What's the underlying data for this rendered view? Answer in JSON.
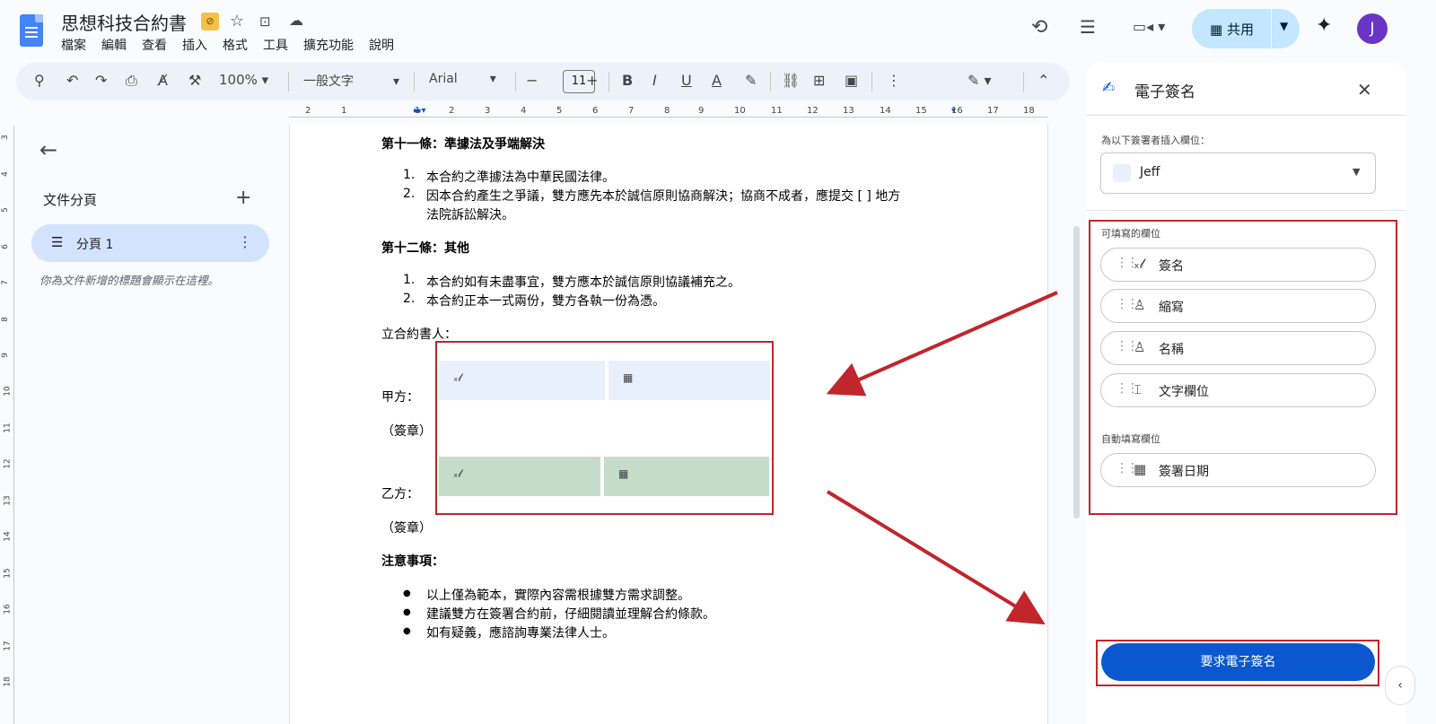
{
  "header": {
    "title": "思想科技合約書",
    "menu": [
      "檔案",
      "編輯",
      "查看",
      "插入",
      "格式",
      "工具",
      "擴充功能",
      "說明"
    ],
    "share_label": "共用",
    "avatar_letter": "J"
  },
  "toolbar": {
    "zoom": "100%",
    "style": "一般文字",
    "font": "Arial",
    "font_size": "11"
  },
  "ruler": {
    "h_ticks": [
      "2",
      "1",
      "1",
      "2",
      "3",
      "4",
      "5",
      "6",
      "7",
      "8",
      "9",
      "10",
      "11",
      "12",
      "13",
      "14",
      "15",
      "16",
      "17",
      "18"
    ],
    "v_ticks": [
      "3",
      "4",
      "5",
      "6",
      "7",
      "8",
      "9",
      "10",
      "11",
      "12",
      "13",
      "14",
      "15",
      "16",
      "17",
      "18"
    ]
  },
  "outline": {
    "title": "文件分頁",
    "tab_label": "分頁 1",
    "hint": "你為文件新增的標題會顯示在這裡。"
  },
  "document": {
    "section11_title": "第十一條：準據法及爭端解決",
    "section11_items": [
      "1.",
      "本合約之準據法為中華民國法律。",
      "2.",
      "因本合約產生之爭議，雙方應先本於誠信原則協商解決；協商不成者，應提交 [ ] 地方",
      "法院訴訟解決。"
    ],
    "section12_title": "第十二條：其他",
    "section12_items": [
      "1.",
      "本合約如有未盡事宜，雙方應本於誠信原則協議補充之。",
      "2.",
      "本合約正本一式兩份，雙方各執一份為憑。"
    ],
    "signers_title": "立合約書人：",
    "party_a": "甲方：",
    "party_a_seal": "（簽章）",
    "party_b": "乙方：",
    "party_b_seal": "（簽章）",
    "notes_title": "注意事項：",
    "notes": [
      "以上僅為範本，實際內容需根據雙方需求調整。",
      "建議雙方在簽署合約前，仔細閱讀並理解合約條款。",
      "如有疑義，應諮詢專業法律人士。"
    ],
    "bullet": "●"
  },
  "esign_panel": {
    "title": "電子簽名",
    "insert_for_label": "為以下簽署者插入欄位：",
    "signer_name": "Jeff",
    "fillable_label": "可填寫的欄位",
    "fillable_fields": [
      "簽名",
      "縮寫",
      "名稱",
      "文字欄位"
    ],
    "auto_label": "自動填寫欄位",
    "auto_fields": [
      "簽署日期"
    ],
    "request_button": "要求電子簽名"
  },
  "colors": {
    "accent": "#0b57d0",
    "share_bg": "#c2e7ff",
    "annotation_red": "#c0262c",
    "party_a_field": "#e8f0fe",
    "party_b_field": "#c5dcc9"
  },
  "icons": [
    "docs-logo-icon",
    "star-icon",
    "move-folder-icon",
    "cloud-status-icon",
    "history-icon",
    "comment-icon",
    "meet-icon",
    "gemini-icon",
    "signature-icon",
    "calendar-icon",
    "person-icon",
    "text-field-icon",
    "close-icon",
    "drag-handle-icon"
  ]
}
